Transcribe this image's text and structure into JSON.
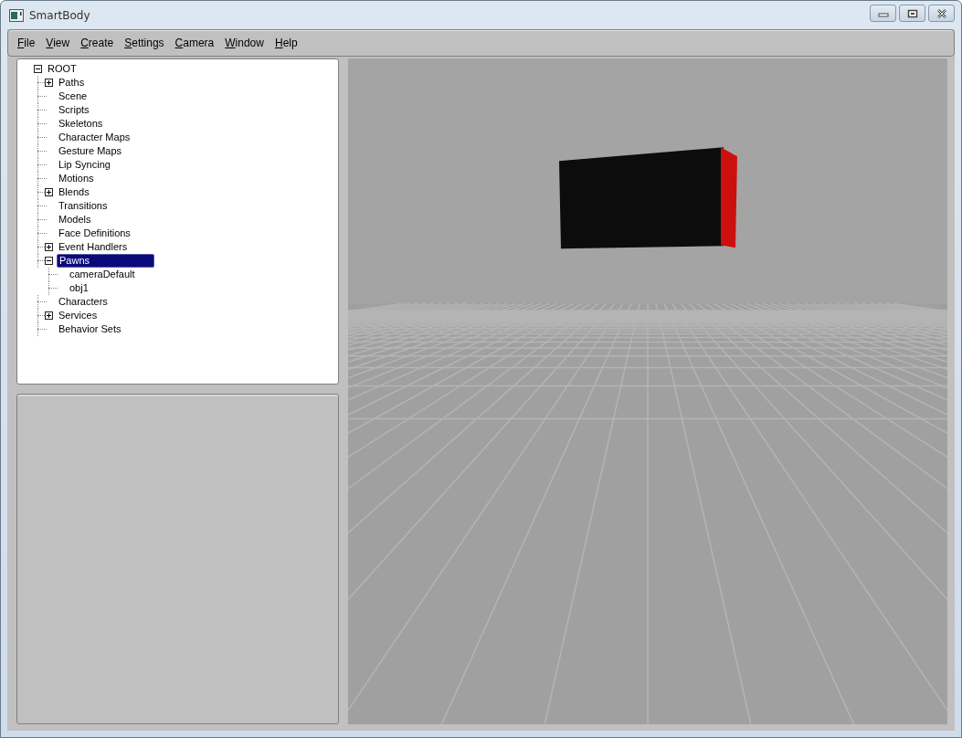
{
  "window": {
    "title": "SmartBody"
  },
  "menu": [
    "File",
    "View",
    "Create",
    "Settings",
    "Camera",
    "Window",
    "Help"
  ],
  "tree": [
    {
      "label": "ROOT",
      "expanded": true,
      "selected": false,
      "children": [
        {
          "label": "Paths",
          "expanded": false,
          "selected": false
        },
        {
          "label": "Scene",
          "selected": false
        },
        {
          "label": "Scripts",
          "selected": false
        },
        {
          "label": "Skeletons",
          "selected": false
        },
        {
          "label": "Character Maps",
          "selected": false
        },
        {
          "label": "Gesture Maps",
          "selected": false
        },
        {
          "label": "Lip Syncing",
          "selected": false
        },
        {
          "label": "Motions",
          "selected": false
        },
        {
          "label": "Blends",
          "expanded": false,
          "selected": false
        },
        {
          "label": "Transitions",
          "selected": false
        },
        {
          "label": "Models",
          "selected": false
        },
        {
          "label": "Face Definitions",
          "selected": false
        },
        {
          "label": "Event Handlers",
          "expanded": false,
          "selected": false
        },
        {
          "label": "Pawns",
          "expanded": true,
          "selected": true,
          "children": [
            {
              "label": "cameraDefault",
              "selected": false
            },
            {
              "label": "obj1",
              "selected": false
            }
          ]
        },
        {
          "label": "Characters",
          "selected": false
        },
        {
          "label": "Services",
          "expanded": false,
          "selected": false
        },
        {
          "label": "Behavior Sets",
          "selected": false
        }
      ]
    }
  ]
}
